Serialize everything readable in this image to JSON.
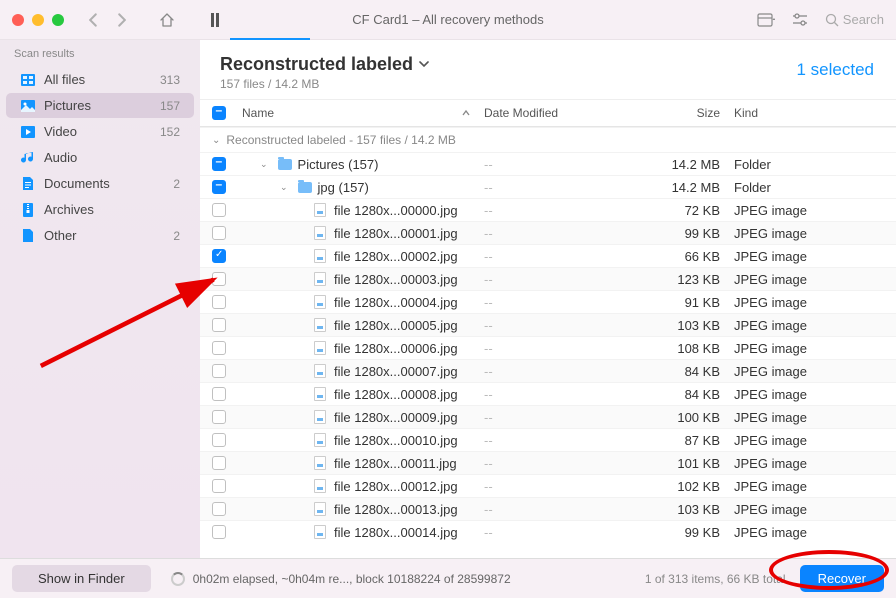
{
  "window_title": "CF Card1 – All recovery methods",
  "search_placeholder": "Search",
  "sidebar": {
    "header": "Scan results",
    "items": [
      {
        "label": "All files",
        "count": "313",
        "icon": "files"
      },
      {
        "label": "Pictures",
        "count": "157",
        "icon": "pictures",
        "active": true
      },
      {
        "label": "Video",
        "count": "152",
        "icon": "video"
      },
      {
        "label": "Audio",
        "count": "",
        "icon": "audio"
      },
      {
        "label": "Documents",
        "count": "2",
        "icon": "documents"
      },
      {
        "label": "Archives",
        "count": "",
        "icon": "archives"
      },
      {
        "label": "Other",
        "count": "2",
        "icon": "other"
      }
    ]
  },
  "content": {
    "title": "Reconstructed labeled",
    "subtitle": "157 files / 14.2 MB",
    "selected_text": "1 selected",
    "columns": {
      "name": "Name",
      "date": "Date Modified",
      "size": "Size",
      "kind": "Kind"
    },
    "group_label": "Reconstructed labeled - 157 files / 14.2 MB",
    "folders": [
      {
        "label": "Pictures (157)",
        "size": "14.2 MB",
        "kind": "Folder",
        "check": "indet"
      },
      {
        "label": "jpg (157)",
        "size": "14.2 MB",
        "kind": "Folder",
        "check": "indet"
      }
    ],
    "files": [
      {
        "name": "file 1280x...00000.jpg",
        "size": "72 KB",
        "kind": "JPEG image",
        "checked": false
      },
      {
        "name": "file 1280x...00001.jpg",
        "size": "99 KB",
        "kind": "JPEG image",
        "checked": false
      },
      {
        "name": "file 1280x...00002.jpg",
        "size": "66 KB",
        "kind": "JPEG image",
        "checked": true
      },
      {
        "name": "file 1280x...00003.jpg",
        "size": "123 KB",
        "kind": "JPEG image",
        "checked": false
      },
      {
        "name": "file 1280x...00004.jpg",
        "size": "91 KB",
        "kind": "JPEG image",
        "checked": false
      },
      {
        "name": "file 1280x...00005.jpg",
        "size": "103 KB",
        "kind": "JPEG image",
        "checked": false
      },
      {
        "name": "file 1280x...00006.jpg",
        "size": "108 KB",
        "kind": "JPEG image",
        "checked": false
      },
      {
        "name": "file 1280x...00007.jpg",
        "size": "84 KB",
        "kind": "JPEG image",
        "checked": false
      },
      {
        "name": "file 1280x...00008.jpg",
        "size": "84 KB",
        "kind": "JPEG image",
        "checked": false
      },
      {
        "name": "file 1280x...00009.jpg",
        "size": "100 KB",
        "kind": "JPEG image",
        "checked": false
      },
      {
        "name": "file 1280x...00010.jpg",
        "size": "87 KB",
        "kind": "JPEG image",
        "checked": false
      },
      {
        "name": "file 1280x...00011.jpg",
        "size": "101 KB",
        "kind": "JPEG image",
        "checked": false
      },
      {
        "name": "file 1280x...00012.jpg",
        "size": "102 KB",
        "kind": "JPEG image",
        "checked": false
      },
      {
        "name": "file 1280x...00013.jpg",
        "size": "103 KB",
        "kind": "JPEG image",
        "checked": false
      },
      {
        "name": "file 1280x...00014.jpg",
        "size": "99 KB",
        "kind": "JPEG image",
        "checked": false
      }
    ],
    "date_placeholder": "--"
  },
  "footer": {
    "show_in_finder": "Show in Finder",
    "status": "0h02m elapsed, ~0h04m re..., block 10188224 of 28599872",
    "selection": "1 of 313 items, 66 KB total",
    "recover": "Recover"
  }
}
